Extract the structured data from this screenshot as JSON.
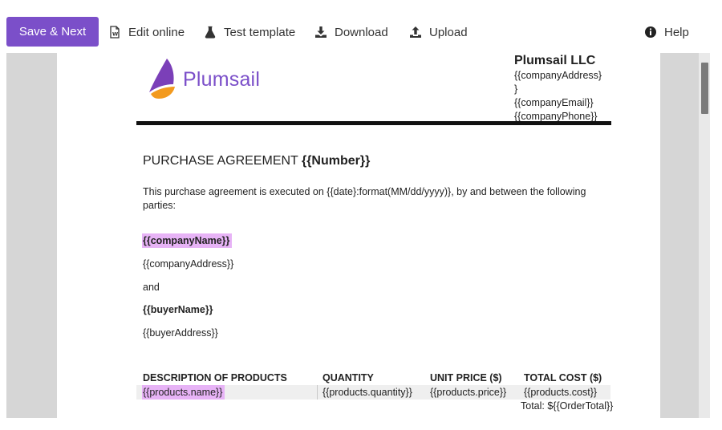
{
  "toolbar": {
    "save_next": "Save & Next",
    "edit_online": "Edit online",
    "test_template": "Test template",
    "download": "Download",
    "upload": "Upload",
    "help": "Help",
    "accent_color": "#7b4fc9"
  },
  "document": {
    "logo_text": "Plumsail",
    "company": {
      "name": "Plumsail LLC",
      "address_line1": "{{companyAddress}",
      "address_line2": "}",
      "email": "{{companyEmail}}",
      "phone": "{{companyPhone}}"
    },
    "title_prefix": "PURCHASE AGREEMENT ",
    "title_token": "{{Number}}",
    "intro": "This purchase agreement is executed on {{date}:format(MM/dd/yyyy)}, by and between the following parties:",
    "company_name": "{{companyName}}",
    "company_address": "{{companyAddress}}",
    "and": "and",
    "buyer_name": "{{buyerName}}",
    "buyer_address": "{{buyerAddress}}",
    "highlight_color": "#e7b3f6",
    "table": {
      "headers": [
        "DESCRIPTION OF PRODUCTS",
        "QUANTITY",
        "UNIT PRICE ($)",
        "TOTAL COST ($)"
      ],
      "row": [
        "{{products.name}}",
        "{{products.quantity}}",
        "{{products.price}}",
        "{{products.cost}}"
      ],
      "total": "Total: ${{OrderTotal}}"
    }
  }
}
